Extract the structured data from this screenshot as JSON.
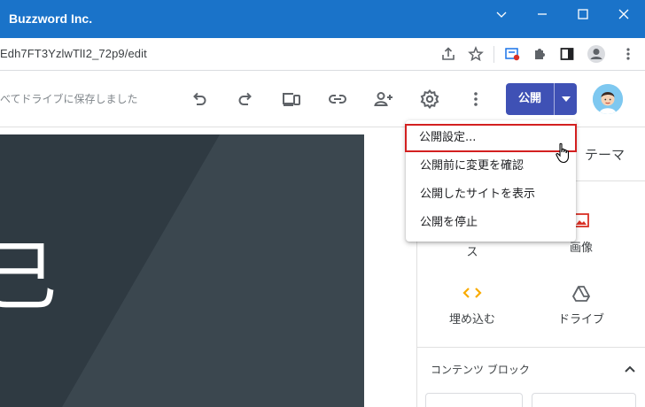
{
  "window": {
    "title": "Buzzword Inc.",
    "controls": [
      "chevron-down-icon",
      "minimize-icon",
      "maximize-icon",
      "close-icon"
    ]
  },
  "address_bar": {
    "url": "Edh7FT3YzlwTlI2_72p9/edit",
    "icons": [
      "share-icon",
      "star-icon",
      "extension-badge-icon",
      "puzzle-icon",
      "side-panel-icon",
      "profile-icon",
      "more-vert-icon"
    ]
  },
  "toolbar": {
    "saved_status": "べてドライブに保存しました",
    "icons": [
      "undo-icon",
      "redo-icon",
      "preview-devices-icon",
      "link-icon",
      "add-person-icon",
      "settings-icon",
      "more-vert-icon"
    ],
    "publish_label": "公開"
  },
  "canvas": {
    "hero_char": "己",
    "colors": {
      "hero_dark": "#2f3a42",
      "hero_light": "#3f4b53"
    }
  },
  "panel": {
    "theme_tab": "テーマ",
    "insert_items": [
      {
        "label": "ス",
        "icon": "text-box-icon"
      },
      {
        "label": "画像",
        "icon": "image-icon"
      },
      {
        "label": "埋め込む",
        "icon": "embed-code-icon"
      },
      {
        "label": "ドライブ",
        "icon": "drive-icon"
      }
    ],
    "blocks_header": "コンテンツ ブロック"
  },
  "publish_menu": {
    "items": [
      {
        "label": "公開設定...",
        "highlighted": true
      },
      {
        "label": "公開前に変更を確認"
      },
      {
        "label": "公開したサイトを表示"
      },
      {
        "label": "公開を停止"
      }
    ],
    "highlight_color": "#d32020"
  },
  "colors": {
    "titlebar": "#1a73c9",
    "publish_button": "#3f51b5",
    "embed_icon": "#f9ab00",
    "image_icon": "#d93025"
  }
}
